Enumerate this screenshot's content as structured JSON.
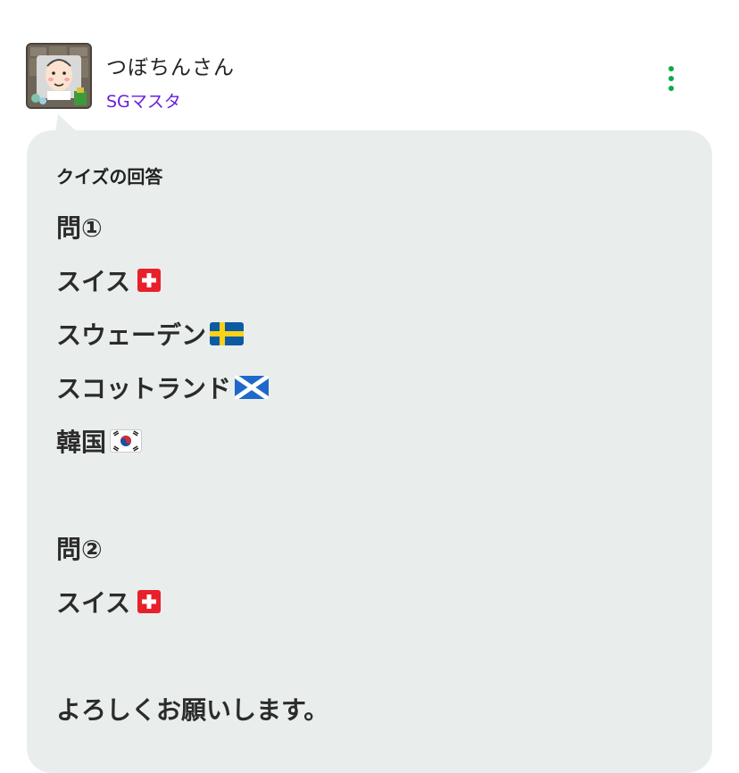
{
  "post": {
    "username": "つぼちんさん",
    "rank": "SGマスタ"
  },
  "message": {
    "heading": "クイズの回答",
    "lines": [
      {
        "text": "問①",
        "flag": ""
      },
      {
        "text": "スイス",
        "flag": "switzerland"
      },
      {
        "text": "スウェーデン",
        "flag": "sweden"
      },
      {
        "text": "スコットランド",
        "flag": "scotland"
      },
      {
        "text": "韓国",
        "flag": "south-korea"
      },
      {
        "text": "問②",
        "flag": ""
      },
      {
        "text": "スイス",
        "flag": "switzerland"
      },
      {
        "text": "よろしくお願いします。",
        "flag": ""
      }
    ]
  },
  "icons": {
    "menu": "more-vertical-icon",
    "avatar": "user-avatar"
  },
  "colors": {
    "bubble_bg": "#e9eeec",
    "rank_text": "#6a1fd8",
    "menu_dots": "#10a84a"
  }
}
